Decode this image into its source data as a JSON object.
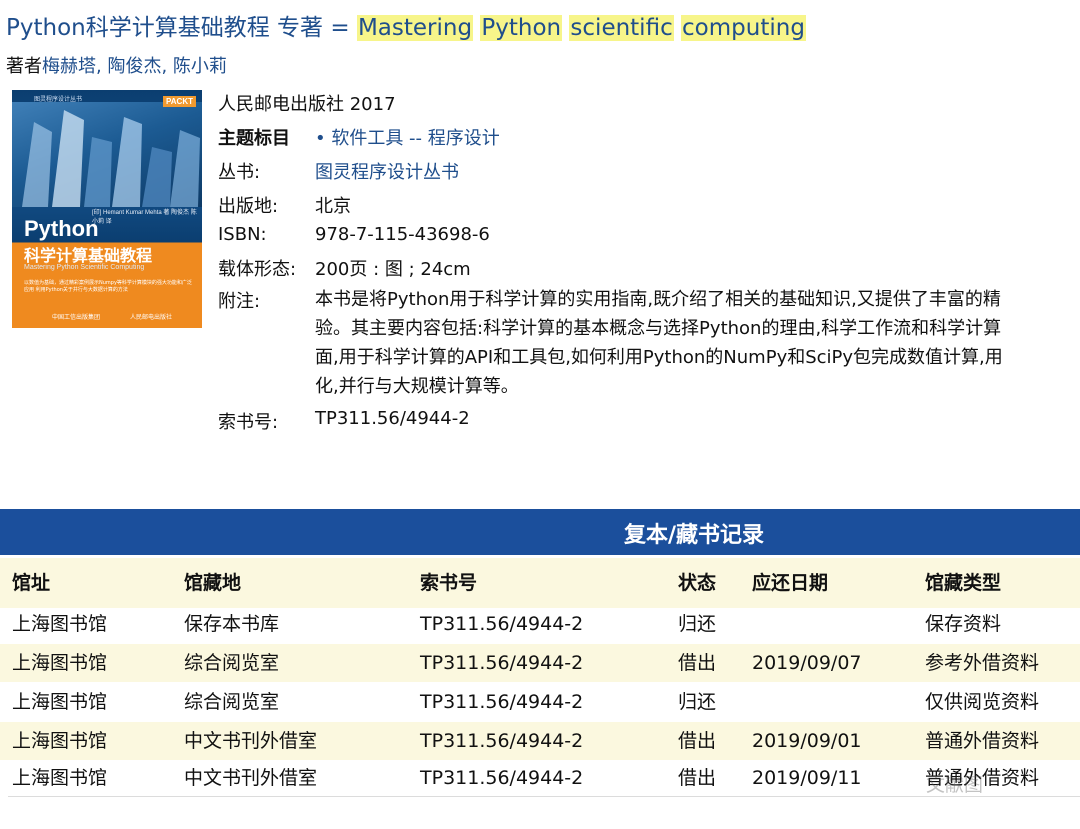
{
  "header": {
    "title_cn": "Python科学计算基础教程 专著 = ",
    "title_en_words": [
      "Mastering",
      "Python",
      "scientific",
      "computing"
    ],
    "author_label": "著者",
    "authors": "梅赫塔, 陶俊杰, 陈小莉"
  },
  "cover": {
    "series": "图灵程序设计丛书",
    "publisher_mark": "PACKT",
    "author_line": "[印] Hemant Kumar Mehta 著  陶俊杰 陈小莉 译",
    "title": "Python",
    "subtitle_cn": "科学计算基础教程",
    "subtitle_en": "Mastering Python Scientific Computing",
    "blurb": "以数值为基础，通过精彩案例展示Numpy等科学计算模块的强大功能和广泛应用\n利用Python关于并行与大数据计算的方法",
    "pub_left": "中国工信出版集团",
    "pub_right": "人民邮电出版社"
  },
  "meta": {
    "publisher": "人民邮电出版社 2017",
    "subject_label": "主题标目",
    "subject_value": "• 软件工具 -- 程序设计",
    "series_label": "丛书:",
    "series_value": "图灵程序设计丛书",
    "place_label": "出版地:",
    "place_value": "北京",
    "isbn_label": "ISBN:",
    "isbn_value": "978-7-115-43698-6",
    "format_label": "载体形态:",
    "format_value": "200页 : 图 ; 24cm",
    "note_label": "附注:",
    "note_lines": [
      "本书是将Python用于科学计算的实用指南,既介绍了相关的基础知识,又提供了丰富的精",
      "验。其主要内容包括:科学计算的基本概念与选择Python的理由,科学工作流和科学计算",
      "面,用于科学计算的API和工具包,如何利用Python的NumPy和SciPy包完成数值计算,用",
      "化,并行与大规模计算等。"
    ],
    "callno_label": "索书号:",
    "callno_value": "TP311.56/4944-2"
  },
  "holdings": {
    "title": "复本/藏书记录",
    "columns": [
      "馆址",
      "馆藏地",
      "索书号",
      "状态",
      "应还日期",
      "馆藏类型"
    ],
    "rows": [
      [
        "上海图书馆",
        "保存本书库",
        "TP311.56/4944-2",
        "归还",
        "",
        "保存资料"
      ],
      [
        "上海图书馆",
        "综合阅览室",
        "TP311.56/4944-2",
        "借出",
        "2019/09/07",
        "参考外借资料"
      ],
      [
        "上海图书馆",
        "综合阅览室",
        "TP311.56/4944-2",
        "归还",
        "",
        "仅供阅览资料"
      ],
      [
        "上海图书馆",
        "中文书刊外借室",
        "TP311.56/4944-2",
        "借出",
        "2019/09/01",
        "普通外借资料"
      ],
      [
        "上海图书馆",
        "中文书刊外借室",
        "TP311.56/4944-2",
        "借出",
        "2019/09/11",
        "普通外借资料"
      ]
    ]
  },
  "watermark": "文献图",
  "colors": {
    "link": "#1f4e8c",
    "highlight": "#f7f58a",
    "header_bar": "#1b4f9c",
    "stripe": "#fbf8df"
  }
}
